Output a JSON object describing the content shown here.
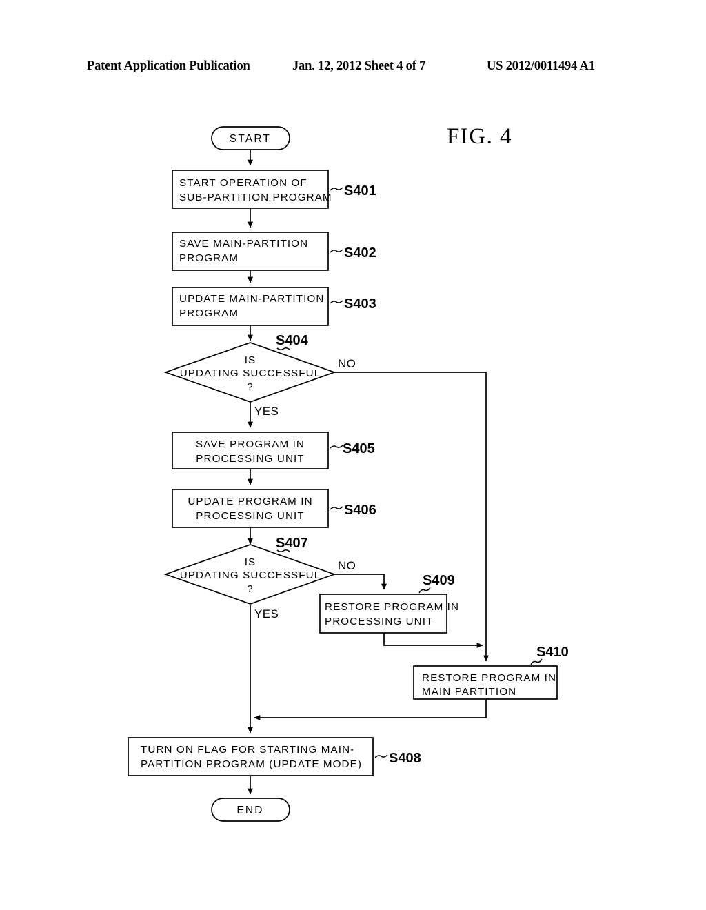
{
  "header": {
    "left": "Patent Application Publication",
    "middle": "Jan. 12, 2012  Sheet 4 of 7",
    "right": "US 2012/0011494 A1"
  },
  "figure": {
    "label": "FIG. 4",
    "colors": {
      "ink": "#000000",
      "paper": "#ffffff"
    }
  },
  "flowchart": {
    "nodes": {
      "start": {
        "kind": "terminator",
        "text": "START"
      },
      "s401": {
        "kind": "process",
        "tag": "S401",
        "line1": "START OPERATION OF",
        "line2": "SUB-PARTITION PROGRAM"
      },
      "s402": {
        "kind": "process",
        "tag": "S402",
        "line1": "SAVE MAIN-PARTITION",
        "line2": "PROGRAM"
      },
      "s403": {
        "kind": "process",
        "tag": "S403",
        "line1": "UPDATE MAIN-PARTITION",
        "line2": "PROGRAM"
      },
      "s404": {
        "kind": "decision",
        "tag": "S404",
        "line1": "IS",
        "line2": "UPDATING SUCCESSFUL",
        "line3": "?",
        "yes": "YES",
        "no": "NO"
      },
      "s405": {
        "kind": "process",
        "tag": "S405",
        "line1": "SAVE PROGRAM IN",
        "line2": "PROCESSING UNIT"
      },
      "s406": {
        "kind": "process",
        "tag": "S406",
        "line1": "UPDATE PROGRAM IN",
        "line2": "PROCESSING UNIT"
      },
      "s407": {
        "kind": "decision",
        "tag": "S407",
        "line1": "IS",
        "line2": "UPDATING SUCCESSFUL",
        "line3": "?",
        "yes": "YES",
        "no": "NO"
      },
      "s409": {
        "kind": "process",
        "tag": "S409",
        "line1": "RESTORE PROGRAM IN",
        "line2": "PROCESSING UNIT"
      },
      "s410": {
        "kind": "process",
        "tag": "S410",
        "line1": "RESTORE PROGRAM IN",
        "line2": "MAIN PARTITION"
      },
      "s408": {
        "kind": "process",
        "tag": "S408",
        "line1": "TURN ON FLAG FOR STARTING MAIN-",
        "line2": "PARTITION PROGRAM (UPDATE MODE)"
      },
      "end": {
        "kind": "terminator",
        "text": "END"
      }
    }
  }
}
